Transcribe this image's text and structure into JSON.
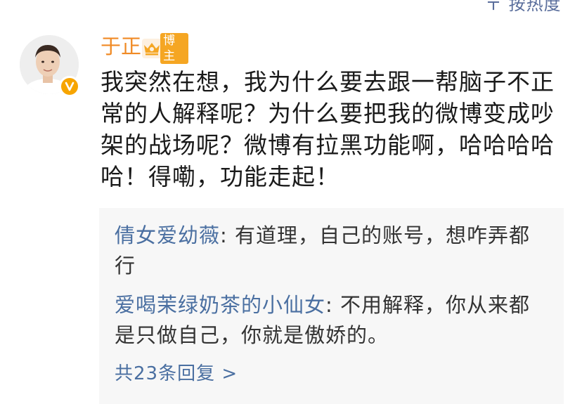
{
  "header": {
    "sort_label": "〒 按热度"
  },
  "post": {
    "username": "于正",
    "badge": "博主",
    "text": "我突然在想，我为什么要去跟一帮脑子不正常的人解释呢？为什么要把我的微博变成吵架的战场呢？微博有拉黑功能啊，哈哈哈哈哈！得嘞，功能走起！"
  },
  "replies": [
    {
      "name": "倩女爱幼薇",
      "sep": ": ",
      "text": "有道理，自己的账号，想咋弄都行"
    },
    {
      "name": "爱喝茉绿奶茶的小仙女",
      "sep": ": ",
      "text": "不用解释，你从来都是只做自己，你就是傲娇的。"
    }
  ],
  "more_replies": "共23条回复 >",
  "colors": {
    "username": "#f08a24",
    "link": "#4a6fa1",
    "reply_bg": "#f7f7f7",
    "verified": "#f7a500"
  },
  "icons": [
    "verified-icon",
    "blogger-badge-icon",
    "avatar"
  ]
}
